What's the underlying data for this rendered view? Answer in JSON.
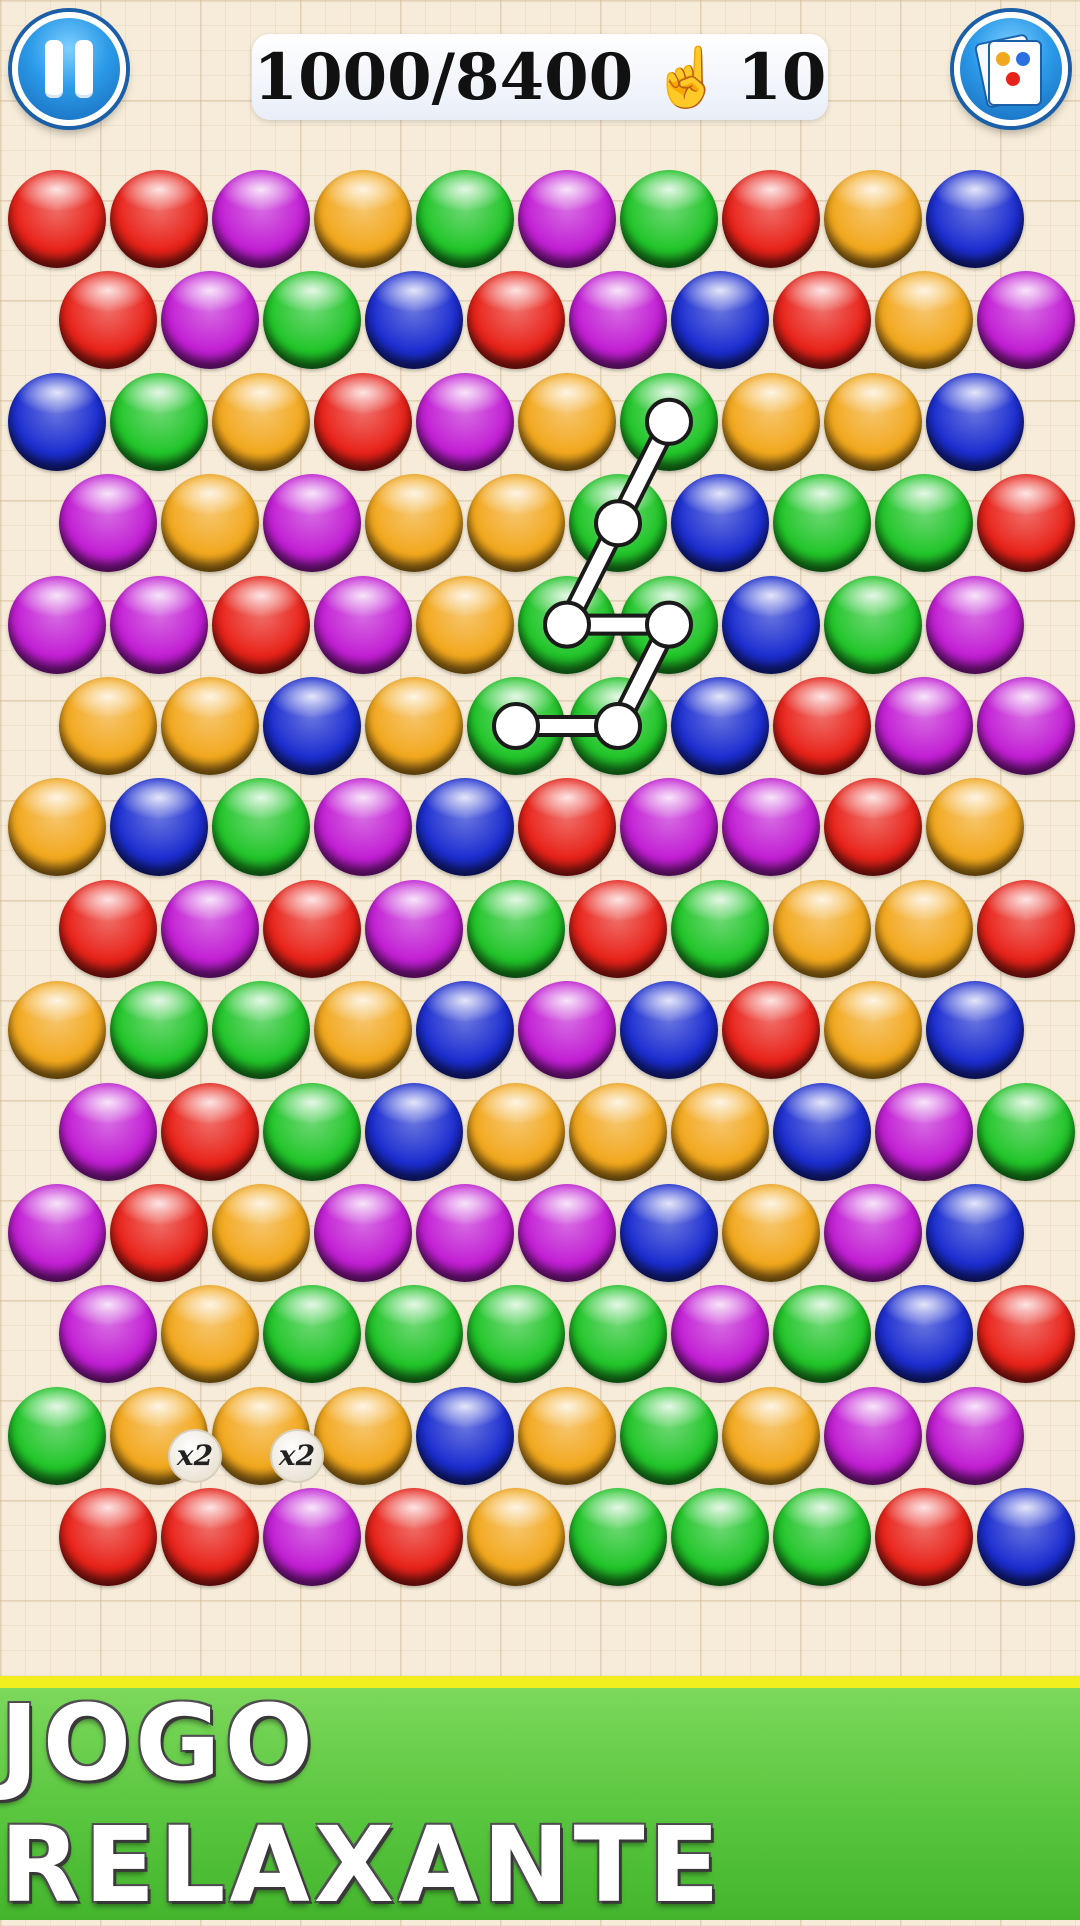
{
  "hud": {
    "score": "1000/8400",
    "moves": "10",
    "pause_icon": "pause-icon",
    "hand_icon": "hand-pointer-icon",
    "cards_icon": "cards-icon"
  },
  "colors": {
    "R": "#e8231a",
    "M": "#c21fd4",
    "Y": "#f2a81e",
    "G": "#22c52a",
    "B": "#1c2ed0"
  },
  "board": {
    "rows": [
      "RRMYGMGRYB",
      "RMGBRMBRYM",
      "BGYRMYGYYB",
      "MYMYYGBGGR",
      "MMRMYGGBGM",
      "YYBYGGBRMM",
      "YBGMBRMMRY",
      "RMRMGRGYYR",
      "YGGYBMBRYB",
      "MRGBYYYBMG",
      "MRYMMMBYMB",
      "MYGGGGMGBR",
      "GYYYBYGYMM",
      "RRMRYGGGRB"
    ],
    "badges": [
      {
        "row": 12,
        "col": 1,
        "label": "x2"
      },
      {
        "row": 12,
        "col": 2,
        "label": "x2"
      }
    ],
    "selected_path": [
      [
        2,
        6
      ],
      [
        3,
        5
      ],
      [
        4,
        5
      ],
      [
        4,
        6
      ],
      [
        5,
        5
      ],
      [
        5,
        4
      ]
    ]
  },
  "banner": {
    "text": "JOGO RELAXANTE"
  }
}
